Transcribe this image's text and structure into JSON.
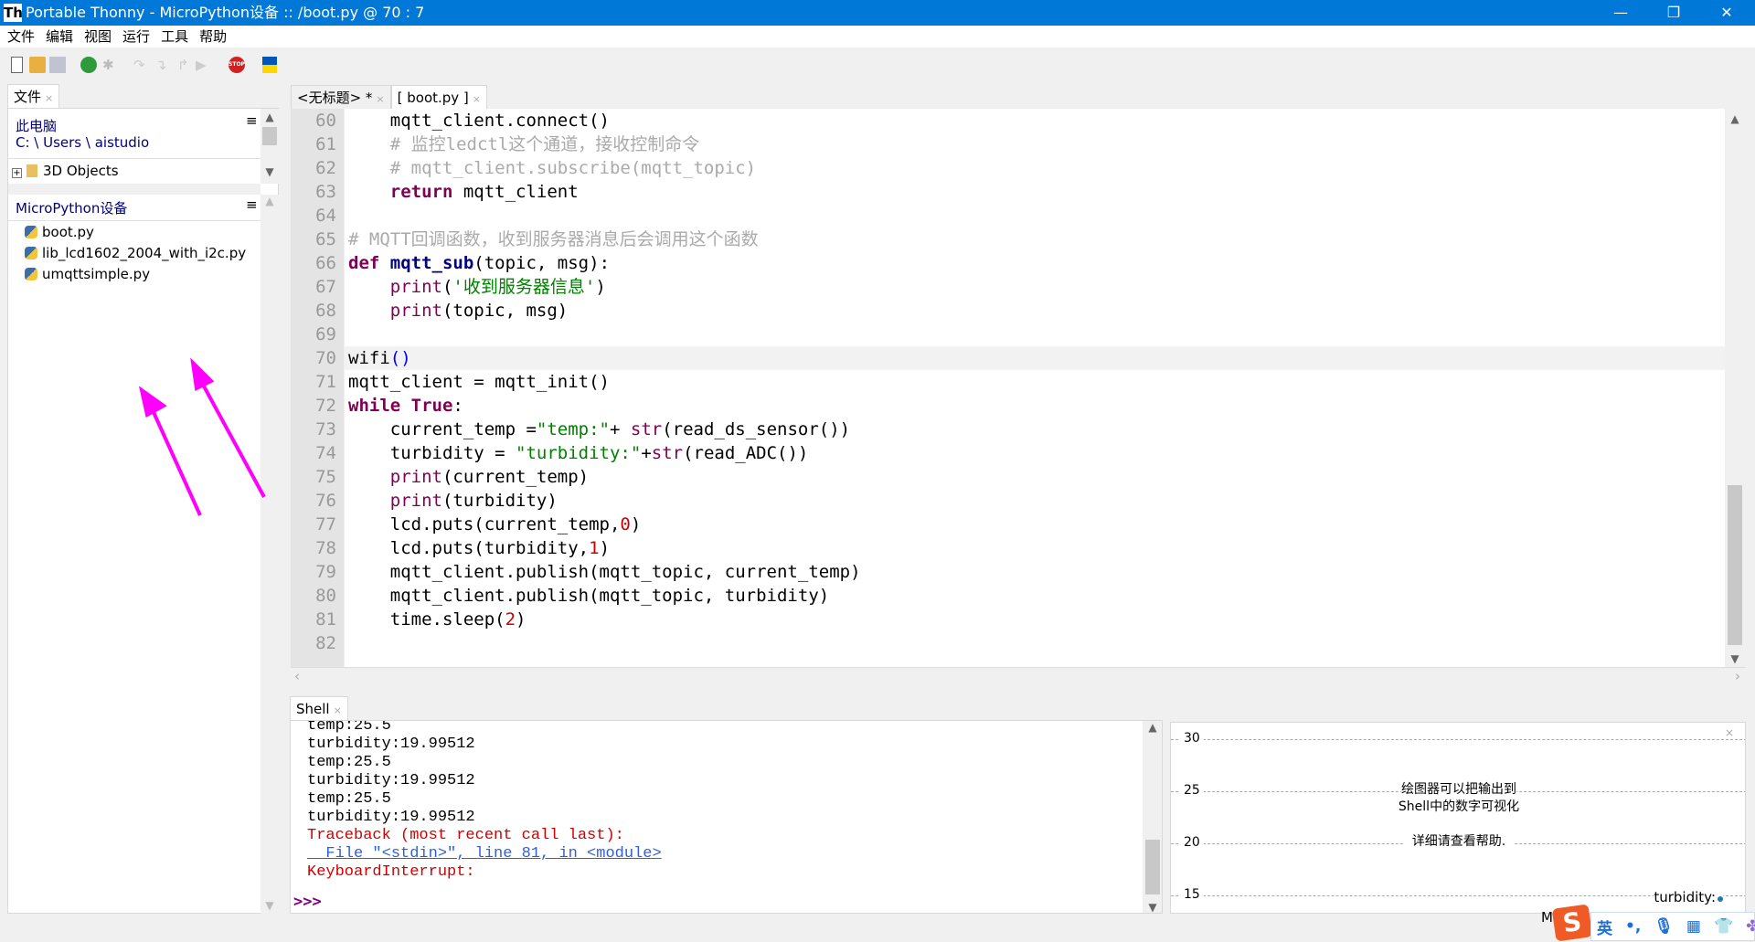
{
  "window": {
    "title": "Portable Thonny  -  MicroPython设备 :: /boot.py  @  70 : 7",
    "logo": "Th",
    "minimize": "—",
    "restore": "❐",
    "close": "✕"
  },
  "menu": [
    "文件",
    "编辑",
    "视图",
    "运行",
    "工具",
    "帮助"
  ],
  "toolbar": {
    "icons": [
      "new-file-icon",
      "open-file-icon",
      "save-icon",
      "run-icon",
      "debug-icon",
      "step-over-icon",
      "step-into-icon",
      "step-out-icon",
      "resume-icon",
      "stop-icon",
      "ukraine-flag-icon"
    ],
    "stop_label": "STOP"
  },
  "files_panel": {
    "tab": "文件",
    "this_pc": "此电脑",
    "path": "C: \\ Users \\ aistudio",
    "pc_items": [
      "3D Objects"
    ],
    "device_title": "MicroPython设备",
    "device_files": [
      "boot.py",
      "lib_lcd1602_2004_with_i2c.py",
      "umqttsimple.py"
    ],
    "menu_glyph": "≡"
  },
  "editor": {
    "tabs": [
      {
        "label": "<无标题> *"
      },
      {
        "label": "[ boot.py ]"
      }
    ],
    "current_line": 70,
    "lines": [
      {
        "n": "60",
        "t": [
          [
            "    mqtt_client.connect()",
            ""
          ]
        ]
      },
      {
        "n": "61",
        "t": [
          [
            "    # 监控ledctl这个通道，接收控制命令",
            "cm"
          ]
        ]
      },
      {
        "n": "62",
        "t": [
          [
            "    # mqtt_client.subscribe(mqtt_topic)",
            "cm"
          ]
        ]
      },
      {
        "n": "63",
        "t": [
          [
            "    ",
            ""
          ],
          [
            "return",
            "kw"
          ],
          [
            " mqtt_client",
            ""
          ]
        ]
      },
      {
        "n": "64",
        "t": []
      },
      {
        "n": "65",
        "t": [
          [
            "# MQTT回调函数，收到服务器消息后会调用这个函数",
            "cm"
          ]
        ]
      },
      {
        "n": "66",
        "t": [
          [
            "def",
            "kw"
          ],
          [
            " ",
            ""
          ],
          [
            "mqtt_sub",
            "fn"
          ],
          [
            "(topic, msg):",
            ""
          ]
        ]
      },
      {
        "n": "67",
        "t": [
          [
            "    ",
            ""
          ],
          [
            "print",
            "bi"
          ],
          [
            "(",
            ""
          ],
          [
            "'收到服务器信息'",
            "st"
          ],
          [
            ")",
            ""
          ]
        ]
      },
      {
        "n": "68",
        "t": [
          [
            "    ",
            ""
          ],
          [
            "print",
            "bi"
          ],
          [
            "(topic, msg)",
            ""
          ]
        ]
      },
      {
        "n": "69",
        "t": []
      },
      {
        "n": "70",
        "t": [
          [
            "wifi",
            ""
          ],
          [
            "()",
            "br"
          ]
        ]
      },
      {
        "n": "71",
        "t": [
          [
            "mqtt_client = mqtt_init()",
            ""
          ]
        ]
      },
      {
        "n": "72",
        "t": [
          [
            "while",
            "kw"
          ],
          [
            " ",
            ""
          ],
          [
            "True",
            "kw"
          ],
          [
            ":",
            ""
          ]
        ]
      },
      {
        "n": "73",
        "t": [
          [
            "    current_temp =",
            ""
          ],
          [
            "\"temp:\"",
            "st"
          ],
          [
            "+ ",
            ""
          ],
          [
            "str",
            "bi"
          ],
          [
            "(read_ds_sensor())",
            ""
          ]
        ]
      },
      {
        "n": "74",
        "t": [
          [
            "    turbidity = ",
            ""
          ],
          [
            "\"turbidity:\"",
            "st"
          ],
          [
            "+",
            ""
          ],
          [
            "str",
            "bi"
          ],
          [
            "(read_ADC())",
            ""
          ]
        ]
      },
      {
        "n": "75",
        "t": [
          [
            "    ",
            ""
          ],
          [
            "print",
            "bi"
          ],
          [
            "(current_temp)",
            ""
          ]
        ]
      },
      {
        "n": "76",
        "t": [
          [
            "    ",
            ""
          ],
          [
            "print",
            "bi"
          ],
          [
            "(turbidity)",
            ""
          ]
        ]
      },
      {
        "n": "77",
        "t": [
          [
            "    lcd.puts(current_temp,",
            ""
          ],
          [
            "0",
            "nu"
          ],
          [
            ")",
            ""
          ]
        ]
      },
      {
        "n": "78",
        "t": [
          [
            "    lcd.puts(turbidity,",
            ""
          ],
          [
            "1",
            "nu"
          ],
          [
            ")",
            ""
          ]
        ]
      },
      {
        "n": "79",
        "t": [
          [
            "    mqtt_client.publish(mqtt_topic, current_temp)",
            ""
          ]
        ]
      },
      {
        "n": "80",
        "t": [
          [
            "    mqtt_client.publish(mqtt_topic, turbidity)",
            ""
          ]
        ]
      },
      {
        "n": "81",
        "t": [
          [
            "    time.sleep(",
            ""
          ],
          [
            "2",
            "nu"
          ],
          [
            ")",
            ""
          ]
        ]
      },
      {
        "n": "82",
        "t": []
      }
    ]
  },
  "shell": {
    "tab": "Shell",
    "lines": [
      {
        "text": "temp:25.5",
        "kind": ""
      },
      {
        "text": "turbidity:19.99512",
        "kind": ""
      },
      {
        "text": "temp:25.5",
        "kind": ""
      },
      {
        "text": "turbidity:19.99512",
        "kind": ""
      },
      {
        "text": "temp:25.5",
        "kind": ""
      },
      {
        "text": "turbidity:19.99512",
        "kind": ""
      },
      {
        "text": "Traceback (most recent call last):",
        "kind": "err"
      },
      {
        "text": "  File \"<stdin>\", line 81, in <module>",
        "kind": "lnk"
      },
      {
        "text": "KeyboardInterrupt:",
        "kind": "err"
      }
    ],
    "prompt": ">>>"
  },
  "plotter": {
    "y_ticks": [
      "30",
      "25",
      "20",
      "15"
    ],
    "message_1": "绘图器可以把输出到",
    "message_2": "Shell中的数字可视化",
    "message_3": "详细请查看帮助.",
    "legend": "turbidity:",
    "legend_color": "#1f77b4",
    "close": "×"
  },
  "ime": {
    "partial": "M",
    "lang": "英",
    "punct": "•,",
    "icons": [
      "sogou-icon",
      "microphone-icon",
      "keyboard-icon",
      "skin-icon",
      "apps-icon"
    ]
  }
}
